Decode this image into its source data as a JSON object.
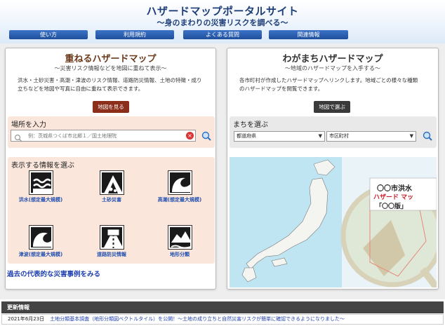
{
  "header": {
    "title": "ハザードマップポータルサイト",
    "subtitle": "～身のまわりの災害リスクを調べる～"
  },
  "nav": [
    {
      "label": "使い方"
    },
    {
      "label": "利用規約"
    },
    {
      "label": "よくある質問"
    },
    {
      "label": "関連情報"
    }
  ],
  "left_panel": {
    "title": "重ねるハザードマップ",
    "subtitle": "～災害リスク情報などを地図に重ねて表示～",
    "desc_line1": "洪水・土砂災害・高潮・津波のリスク情報、道路防災情報、土地の特徴・成り",
    "desc_line2": "立ちなどを地図や写真に自由に重ねて表示できます。",
    "button_label": "地図を見る",
    "location_title": "場所を入力",
    "search_placeholder": "例：茨城県つくば市北郷１／国土地理院",
    "info_title": "表示する情報を選ぶ",
    "items": [
      {
        "label": "洪水(想定最大規模)",
        "icon": "flood-icon"
      },
      {
        "label": "土砂災害",
        "icon": "landslide-icon"
      },
      {
        "label": "高潮(想定最大規模)",
        "icon": "storm-surge-icon"
      },
      {
        "label": "津波(想定最大規模)",
        "icon": "tsunami-icon"
      },
      {
        "label": "道路防災情報",
        "icon": "road-disaster-icon"
      },
      {
        "label": "地形分類",
        "icon": "landform-icon"
      }
    ],
    "past_link": "過去の代表的な災害事例をみる"
  },
  "right_panel": {
    "title": "わがまちハザードマップ",
    "subtitle": "～地域のハザードマップを入手する～",
    "desc_line1": "各市町村が作成したハザードマップへリンクします。地域ごとの様々な種類",
    "desc_line2": "のハザードマップを閲覧できます。",
    "button_label": "地図で選ぶ",
    "town_title": "まちを選ぶ",
    "prefecture_select": "都道府県",
    "city_select": "市区町村",
    "sign_line1": "〇〇市洪水",
    "sign_line2": "ハザード マッ",
    "sign_line3": "「〇〇版」"
  },
  "news": {
    "header": "更新情報",
    "date": "2021年6月23日",
    "text": "土地分類基本調査（地形分類図ベクトルタイル）を公開！～土地の成り立ちと自然災害リスクが簡単に確認できるようになりました～"
  },
  "colors": {
    "nav_blue": "#2a5cb0",
    "title_navy": "#1f3f7a",
    "left_title": "#6b3a1c",
    "left_button": "#8b2f1a",
    "right_button": "#3a3a3a",
    "section_pink": "#fbe6dc",
    "section_gray": "#e9e9e9",
    "link_blue": "#1f3fb0"
  }
}
